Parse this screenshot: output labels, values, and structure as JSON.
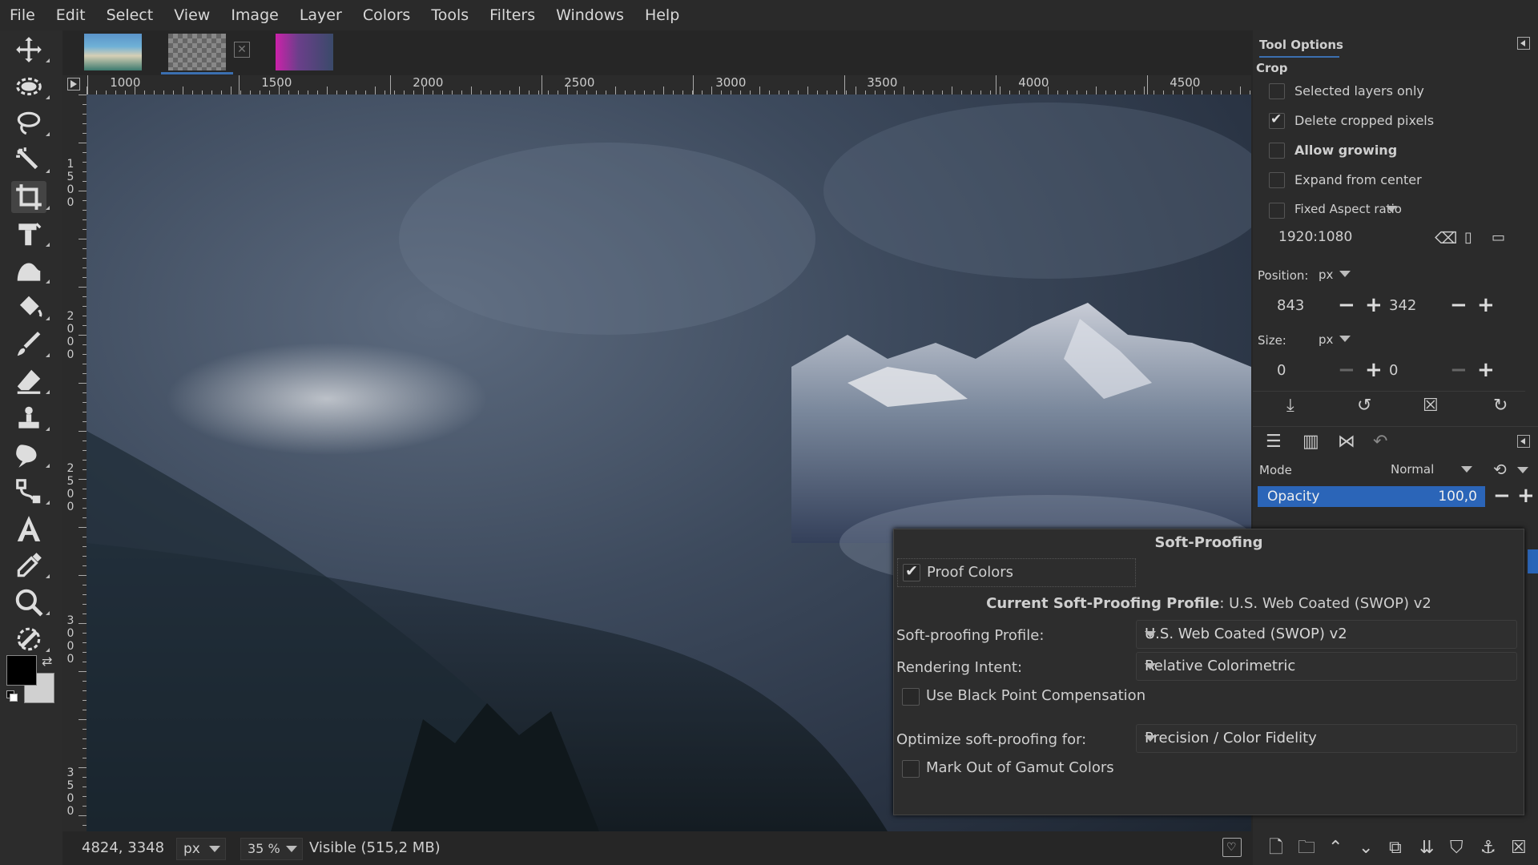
{
  "menubar": [
    "File",
    "Edit",
    "Select",
    "View",
    "Image",
    "Layer",
    "Colors",
    "Tools",
    "Filters",
    "Windows",
    "Help"
  ],
  "ruler": {
    "h_labels": [
      "1000",
      "1500",
      "2000",
      "2500",
      "3000",
      "3500",
      "4000",
      "4500"
    ],
    "v_labels": [
      [
        "1",
        "5",
        "0",
        "0"
      ],
      [
        "2",
        "0",
        "0",
        "0"
      ],
      [
        "2",
        "5",
        "0",
        "0"
      ],
      [
        "3",
        "0",
        "0",
        "0"
      ],
      [
        "3",
        "5",
        "0",
        "0"
      ]
    ]
  },
  "statusbar": {
    "coords": "4824, 3348",
    "unit": "px",
    "zoom": "35 %",
    "info": "Visible (515,2 MB)"
  },
  "tool_options": {
    "title": "Tool Options",
    "tool_name": "Crop",
    "selected_layers_only": {
      "label": "Selected layers only",
      "checked": false
    },
    "delete_cropped_pixels": {
      "label": "Delete cropped pixels",
      "checked": true
    },
    "allow_growing": {
      "label": "Allow growing",
      "checked": false
    },
    "expand_from_center": {
      "label": "Expand from center",
      "checked": false
    },
    "fixed_label": "Fixed Aspect ratio",
    "ratio_value": "1920:1080",
    "position_label": "Position:",
    "position_unit": "px",
    "position_x": "843",
    "position_y": "342",
    "size_label": "Size:",
    "size_unit": "px",
    "size_w": "0",
    "size_h": "0"
  },
  "layers": {
    "mode_label": "Mode",
    "mode_value": "Normal",
    "opacity_label": "Opacity",
    "opacity_value": "100,0",
    "opacity_fraction": 1.0
  },
  "soft_proofing": {
    "title": "Soft-Proofing",
    "proof_colors": {
      "label": "Proof Colors",
      "checked": true
    },
    "current_profile_label": "Current Soft-Proofing Profile",
    "current_profile_value": ": U.S. Web Coated (SWOP) v2",
    "profile_label": "Soft-proofing Profile:",
    "profile_value": "U.S. Web Coated (SWOP) v2",
    "intent_label": "Rendering Intent:",
    "intent_value": "Relative Colorimetric",
    "bpc": {
      "label": "Use Black Point Compensation",
      "checked": false
    },
    "optimize_label": "Optimize soft-proofing for:",
    "optimize_value": "Precision / Color Fidelity",
    "gamut": {
      "label": "Mark Out of Gamut Colors",
      "checked": false
    }
  },
  "colors": {
    "foreground": "#000000",
    "background": "#d0d0d0",
    "opacity_bar": "#2b65b8"
  }
}
